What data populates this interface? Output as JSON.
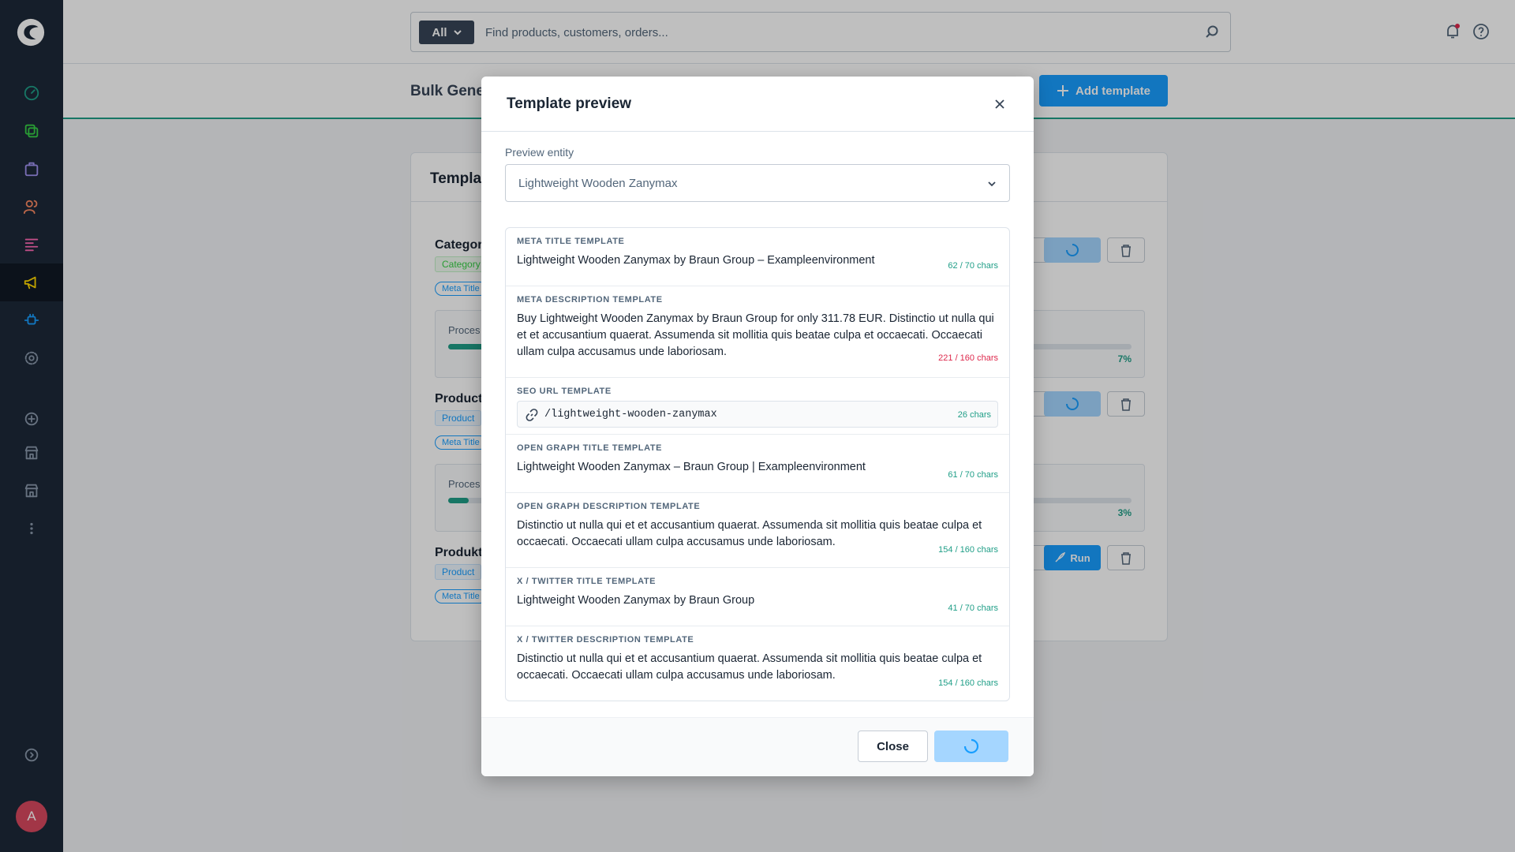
{
  "topbar": {
    "search_filter_label": "All",
    "search_placeholder": "Find products, customers, orders..."
  },
  "page": {
    "title": "Bulk Gene",
    "add_template_label": "Add template"
  },
  "card": {
    "title": "Templa",
    "templates": [
      {
        "name": "Categor",
        "tag": "Category",
        "pill": "Meta Title",
        "process_label": "Proces",
        "progress_percent": 7,
        "progress_text": "7%"
      },
      {
        "name": "Product",
        "tag": "Product",
        "pill": "Meta Title",
        "process_label": "Proces",
        "progress_percent": 3,
        "progress_text": "3%"
      },
      {
        "name": "Produkte",
        "tag": "Product",
        "pill": "Meta Title",
        "run_label": "Run"
      }
    ]
  },
  "modal": {
    "title": "Template preview",
    "preview_entity_label": "Preview entity",
    "preview_entity_value": "Lightweight Wooden Zanymax",
    "items": [
      {
        "label": "META TITLE TEMPLATE",
        "text": "Lightweight Wooden Zanymax by Braun Group – Exampleenvironment",
        "count": "62 / 70 chars",
        "over": false
      },
      {
        "label": "META DESCRIPTION TEMPLATE",
        "text": "Buy Lightweight Wooden Zanymax by Braun Group for only 311.78 EUR. Distinctio ut nulla qui et et accusantium quaerat. Assumenda sit mollitia quis beatae culpa et occaecati. Occaecati ullam culpa accusamus unde laboriosam.",
        "count": "221 / 160 chars",
        "over": true
      },
      {
        "label": "SEO URL TEMPLATE",
        "url": "/lightweight-wooden-zanymax",
        "count": "26 chars"
      },
      {
        "label": "OPEN GRAPH TITLE TEMPLATE",
        "text": "Lightweight Wooden Zanymax – Braun Group | Exampleenvironment",
        "count": "61 / 70 chars",
        "over": false
      },
      {
        "label": "OPEN GRAPH DESCRIPTION TEMPLATE",
        "text": "Distinctio ut nulla qui et et accusantium quaerat. Assumenda sit mollitia quis beatae culpa et occaecati. Occaecati ullam culpa accusamus unde laboriosam.",
        "count": "154 / 160 chars",
        "over": false
      },
      {
        "label": "X / TWITTER TITLE TEMPLATE",
        "text": "Lightweight Wooden Zanymax by Braun Group",
        "count": "41 / 70 chars",
        "over": false
      },
      {
        "label": "X / TWITTER DESCRIPTION TEMPLATE",
        "text": "Distinctio ut nulla qui et et accusantium quaerat. Assumenda sit mollitia quis beatae culpa et occaecati. Occaecati ullam culpa accusamus unde laboriosam.",
        "count": "154 / 160 chars",
        "over": false
      }
    ],
    "close_label": "Close"
  },
  "user": {
    "avatar_initial": "A"
  },
  "colors": {
    "accent": "#189eff",
    "success": "#1f9e87",
    "danger": "#de294c",
    "sidebar": "#1d2939"
  }
}
